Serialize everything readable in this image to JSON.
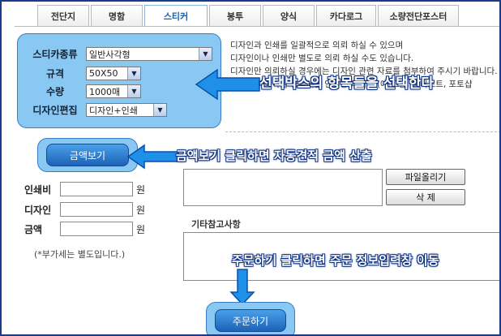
{
  "tabs": [
    "전단지",
    "명함",
    "스티커",
    "봉투",
    "양식",
    "카다로그",
    "소량전단포스터"
  ],
  "active_tab": "스티커",
  "options": {
    "sticker_type_label": "스티카종류",
    "sticker_type_value": "일반사각형",
    "size_label": "규격",
    "size_value": "50X50",
    "quantity_label": "수량",
    "quantity_value": "1000매",
    "design_label": "디자인편집",
    "design_value": "디자인+인쇄"
  },
  "description": [
    "디자인과 인쇄를 일괄적으로 의뢰 하실 수 있으며",
    "디자인이나 인쇄만 별도로 의뢰 하실 수도 있습니다.",
    "디자인만 의뢰하실 경우에는 디자인 관련 자료를 첨부하여 주시기 바랍니다. 일체 일정",
    "인쇄만 의뢰하실 경우에는 인쇄용 데이터 (예:고용, 일러스트, 포토샵"
  ],
  "annotations": {
    "select": "선택박스의 항목들을 선택한다",
    "price": "금액보기 클릭하면 자동견적 금액 산출",
    "order": "주문하기 클릭하면 주문 정보입력창 이동"
  },
  "buttons": {
    "view_price": "금액보기",
    "upload": "파일올리기",
    "delete": "삭 제",
    "order": "주문하기"
  },
  "price": {
    "print_label": "인쇄비",
    "design_label": "디자인",
    "total_label": "금액",
    "unit": "원",
    "vat_note": "(*부가세는 별도입니다.)"
  },
  "etc_label": "기타참고사항",
  "colors": {
    "accent": "#1b5fb0",
    "callout_arrow": "#1e90e8",
    "box_fill": "#8ac8f4"
  }
}
